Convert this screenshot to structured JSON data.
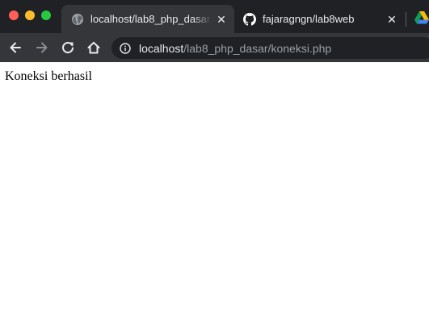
{
  "window": {
    "traffic_lights": [
      "close",
      "minimize",
      "maximize"
    ]
  },
  "tabs": [
    {
      "title": "localhost/lab8_php_dasar/koneksi.php",
      "favicon": "globe-icon",
      "active": true,
      "close_label": "✕"
    },
    {
      "title": "fajaragngn/lab8web",
      "favicon": "github-icon",
      "active": false,
      "close_label": "✕"
    },
    {
      "title": "",
      "favicon": "google-drive-icon",
      "active": false
    }
  ],
  "toolbar": {
    "back": "arrow-left-icon",
    "forward": "arrow-right-icon",
    "reload": "reload-icon",
    "home": "home-icon"
  },
  "address_bar": {
    "icon": "info-icon",
    "host": "localhost",
    "path": "/lab8_php_dasar/koneksi.php"
  },
  "page": {
    "text": "Koneksi berhasil"
  },
  "colors": {
    "tab_strip": "#202124",
    "active_tab": "#35363a",
    "omnibox": "#202124",
    "text_light": "#e8eaed",
    "text_dim": "#9aa0a6",
    "page_background": "#ffffff"
  }
}
